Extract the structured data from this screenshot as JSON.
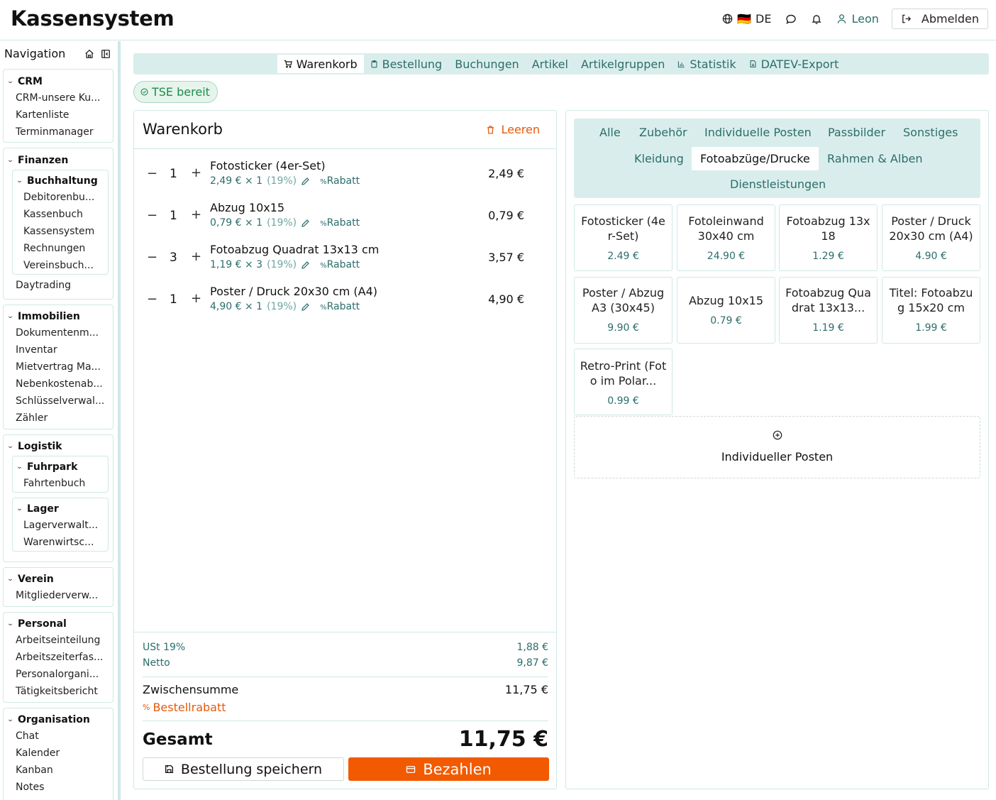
{
  "app": {
    "title": "Kassensystem"
  },
  "header": {
    "language": "DE",
    "flag": "🇩🇪",
    "user": "Leon",
    "logout": "Abmelden"
  },
  "sidebar": {
    "title": "Navigation",
    "groups": [
      {
        "title": "CRM",
        "items": [
          "CRM-unsere Ku...",
          "Kartenliste",
          "Terminmanager"
        ]
      },
      {
        "title": "Finanzen",
        "sub": {
          "title": "Buchhaltung",
          "items": [
            "Debitorenbu...",
            "Kassenbuch",
            "Kassensystem",
            "Rechnungen",
            "Vereinsbuch..."
          ]
        },
        "items": [
          "Daytrading"
        ]
      },
      {
        "title": "Immobilien",
        "items": [
          "Dokumentenm...",
          "Inventar",
          "Mietvertrag Ma...",
          "Nebenkostenab...",
          "Schlüsselverwal...",
          "Zähler"
        ]
      },
      {
        "title": "Logistik",
        "subs": [
          {
            "title": "Fuhrpark",
            "items": [
              "Fahrtenbuch"
            ]
          },
          {
            "title": "Lager",
            "items": [
              "Lagerverwalt...",
              "Warenwirtsc..."
            ]
          }
        ]
      },
      {
        "title": "Verein",
        "items": [
          "Mitgliederverw..."
        ]
      },
      {
        "title": "Personal",
        "items": [
          "Arbeitseinteilung",
          "Arbeitszeiterfas...",
          "Personalorgani...",
          "Tätigkeitsbericht"
        ]
      },
      {
        "title": "Organisation",
        "items": [
          "Chat",
          "Kalender",
          "Kanban",
          "Notes"
        ]
      }
    ]
  },
  "tabs": [
    "Warenkorb",
    "Bestellung",
    "Buchungen",
    "Artikel",
    "Artikelgruppen",
    "Statistik",
    "DATEV-Export"
  ],
  "status": {
    "tse": "TSE bereit"
  },
  "cart": {
    "title": "Warenkorb",
    "clear": "Leeren",
    "items": [
      {
        "name": "Fotosticker (4er-Set)",
        "qty": "1",
        "unit": "2,49 € × 1",
        "vat": "(19%)",
        "discount": "Rabatt",
        "total": "2,49 €"
      },
      {
        "name": "Abzug 10x15",
        "qty": "1",
        "unit": "0,79 € × 1",
        "vat": "(19%)",
        "discount": "Rabatt",
        "total": "0,79 €"
      },
      {
        "name": "Fotoabzug Quadrat 13x13 cm",
        "qty": "3",
        "unit": "1,19 € × 3",
        "vat": "(19%)",
        "discount": "Rabatt",
        "total": "3,57 €"
      },
      {
        "name": "Poster / Druck 20x30 cm (A4)",
        "qty": "1",
        "unit": "4,90 € × 1",
        "vat": "(19%)",
        "discount": "Rabatt",
        "total": "4,90 €"
      }
    ],
    "vat_label": "USt 19%",
    "vat_value": "1,88 €",
    "net_label": "Netto",
    "net_value": "9,87 €",
    "subtotal_label": "Zwischensumme",
    "subtotal_value": "11,75 €",
    "order_discount": "Bestellrabatt",
    "total_label": "Gesamt",
    "total_value": "11,75 €",
    "save": "Bestellung speichern",
    "pay": "Bezahlen"
  },
  "categories": [
    "Alle",
    "Zubehör",
    "Individuelle Posten",
    "Passbilder",
    "Sonstiges",
    "Kleidung",
    "Fotoabzüge/Drucke",
    "Rahmen & Alben",
    "Dienstleistungen"
  ],
  "products": [
    {
      "name": "Fotosticker (4er-Set)",
      "price": "2.49 €"
    },
    {
      "name": "Fotoleinwand 30x40 cm",
      "price": "24.90 €"
    },
    {
      "name": "Fotoabzug 13x18",
      "price": "1.29 €"
    },
    {
      "name": "Poster / Druck 20x30 cm (A4)",
      "price": "4.90 €"
    },
    {
      "name": "Poster / Abzug A3 (30x45)",
      "price": "9.90 €"
    },
    {
      "name": "Abzug 10x15",
      "price": "0.79 €"
    },
    {
      "name": "Fotoabzug Quadrat 13x13...",
      "price": "1.19 €"
    },
    {
      "name": "Titel: Fotoabzug 15x20 cm",
      "price": "1.99 €"
    },
    {
      "name": "Retro-Print (Foto im Polar...",
      "price": "0.99 €"
    }
  ],
  "custom_item": "Individueller Posten",
  "colors": {
    "accent": "#2c6e6b",
    "tab_bg": "#d9eeec",
    "pay": "#f25a00",
    "warning": "#e8590c",
    "tse": "#1f8a4c"
  }
}
